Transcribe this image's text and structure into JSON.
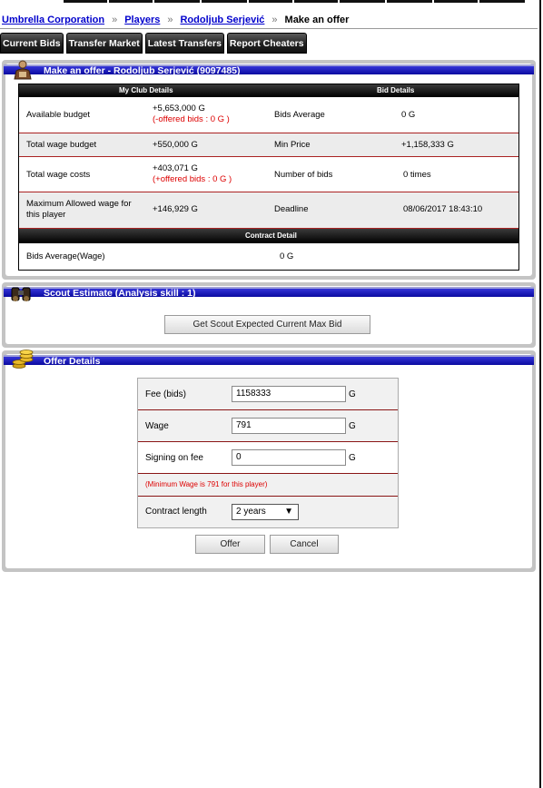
{
  "breadcrumb": {
    "items": [
      "Umbrella Corporation",
      "Players",
      "Rodoljub Serjević"
    ],
    "separator": "»",
    "current": "Make an offer"
  },
  "nav": [
    "Current Bids",
    "Transfer Market",
    "Latest Transfers",
    "Report Cheaters"
  ],
  "offer_panel": {
    "title": "Make an offer - Rodoljub Serjević (9097485)",
    "left_header": "My Club Details",
    "right_header": "Bid Details",
    "rows": [
      {
        "label": "Available budget",
        "value": "+5,653,000 G",
        "note": "(-offered bids : 0 G )",
        "label2": "Bids Average",
        "value2": "0 G"
      },
      {
        "label": "Total wage budget",
        "value": "+550,000 G",
        "note": "",
        "label2": "Min Price",
        "value2": "+1,158,333 G"
      },
      {
        "label": "Total wage costs",
        "value": "+403,071 G",
        "note": "(+offered bids : 0 G )",
        "label2": "Number of bids",
        "value2": "0 times"
      },
      {
        "label": "Maximum Allowed wage for this player",
        "value": "+146,929 G",
        "note": "",
        "label2": "Deadline",
        "value2": "08/06/2017 18:43:10"
      }
    ],
    "contract_header": "Contract Detail",
    "contract_row": {
      "label": "Bids Average(Wage)",
      "value": "0 G"
    }
  },
  "scout_panel": {
    "title": "Scout Estimate (Analysis skill : 1)",
    "button": "Get Scout Expected Current Max Bid"
  },
  "details_panel": {
    "title": "Offer Details",
    "fee_label": "Fee (bids)",
    "fee_value": "1158333",
    "wage_label": "Wage",
    "wage_value": "791",
    "signing_label": "Signing on fee",
    "signing_value": "0",
    "unit": "G",
    "min_wage_note": "(Minimum Wage is 791 for this player)",
    "contract_label": "Contract length",
    "contract_value": "2 years",
    "offer_button": "Offer",
    "cancel_button": "Cancel"
  },
  "colors": {
    "title_bar": "#1a1ab5",
    "note_red": "#dd0000",
    "row_border": "#aa2222",
    "link": "#0000cc"
  }
}
